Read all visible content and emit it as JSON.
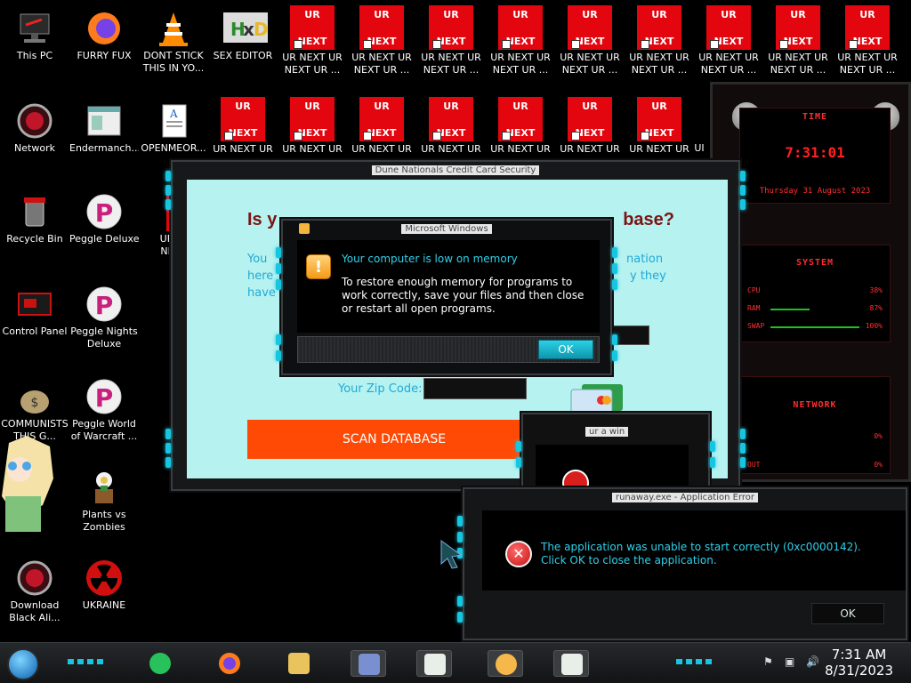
{
  "desktop": {
    "left_icons": [
      {
        "label1": "This PC",
        "label2": ""
      },
      {
        "label1": "Network",
        "label2": ""
      },
      {
        "label1": "Recycle Bin",
        "label2": ""
      },
      {
        "label1": "Control Panel",
        "label2": ""
      },
      {
        "label1": "COMMUNISTS",
        "label2": "THIS G..."
      },
      {
        "label1": "Download",
        "label2": "Black Ali..."
      }
    ],
    "second_col_icons": [
      {
        "label1": "FURRY FUX",
        "label2": ""
      },
      {
        "label1": "Endermanch...",
        "label2": ""
      },
      {
        "label1": "Peggle Deluxe",
        "label2": ""
      },
      {
        "label1": "Peggle Nights",
        "label2": "Deluxe"
      },
      {
        "label1": "Peggle World",
        "label2": "of Warcraft ..."
      },
      {
        "label1": "Plants vs",
        "label2": "Zombies"
      },
      {
        "label1": "UKRAINE",
        "label2": ""
      }
    ],
    "third_col_icons": [
      {
        "label1": "DONT STICK",
        "label2": "THIS IN YO..."
      },
      {
        "label1": "OPENMEOR...",
        "label2": ""
      },
      {
        "label1": "UR NI",
        "label2": "NEXT"
      }
    ],
    "hex_editor": {
      "label": "SEX EDITOR"
    },
    "ur_tile": {
      "top": "UR",
      "bottom": "NEXT",
      "label1": "UR NEXT UR",
      "label2": "NEXT UR ..."
    },
    "ur_row2_label": "UR NEXT UR",
    "ur_row2_partial": "UI"
  },
  "main_window": {
    "title": "Dune Nationals Credit Card Security",
    "headline_left": "Is y",
    "headline_right": "base?",
    "para_left_1": "You",
    "para_left_2": "here",
    "para_left_3": "have",
    "para_right_1": "nation",
    "para_right_2": "y they",
    "zip_label": "Your Zip Code:",
    "scan_button": "SCAN DATABASE"
  },
  "memory_dialog": {
    "title": "Microsoft Windows",
    "heading": "Your computer is low on memory",
    "body": "To restore enough memory for programs to work correctly, save your files and then close or restart all open programs.",
    "ok": "OK"
  },
  "small_dialog": {
    "title": "ur a win"
  },
  "app_error": {
    "title": "runaway.exe - Application Error",
    "message": "The application was unable to start correctly (0xc0000142). Click OK to close the application.",
    "ok": "OK"
  },
  "widget": {
    "time_title": "TIME",
    "time": "7:31:01",
    "date": "Thursday 31 August 2023",
    "system_title": "SYSTEM",
    "cpu_label": "CPU",
    "cpu_value": "38%",
    "cpu_level": 0.38,
    "ram_label": "RAM",
    "ram_value": "87%",
    "ram_level": 0.87,
    "swap_label": "SWAP",
    "swap_value": "100%",
    "swap_level": 1.0,
    "network_title": "NETWORK",
    "net_in": "0%",
    "net_out": "0%",
    "out_label": "OUT"
  },
  "taskbar": {
    "time": "7:31 AM",
    "date": "8/31/2023"
  },
  "colors": {
    "accent": "#16c5e0",
    "scan": "#ff4a06",
    "ur_red": "#e3060f"
  }
}
